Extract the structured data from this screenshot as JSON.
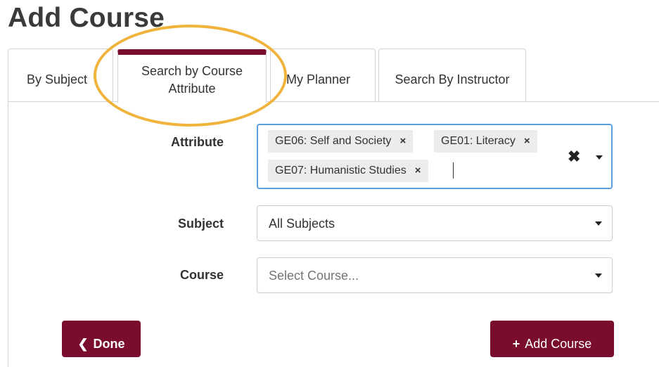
{
  "page": {
    "title": "Add Course"
  },
  "tabs": [
    {
      "label": "By Subject"
    },
    {
      "label": "Search by Course Attribute"
    },
    {
      "label": "My Planner"
    },
    {
      "label": "Search By Instructor"
    }
  ],
  "active_tab": "Search by Course Attribute",
  "form": {
    "attribute": {
      "label": "Attribute",
      "chips": [
        {
          "label": "GE06: Self and Society"
        },
        {
          "label": "GE01: Literacy"
        },
        {
          "label": "GE07: Humanistic Studies"
        }
      ],
      "remove_glyph": "×",
      "clear_glyph": "✖"
    },
    "subject": {
      "label": "Subject",
      "value": "All Subjects"
    },
    "course": {
      "label": "Course",
      "placeholder": "Select Course..."
    }
  },
  "buttons": {
    "done": {
      "icon": "chevron-left-icon",
      "glyph": "❮",
      "label": "Done"
    },
    "add": {
      "icon": "plus-icon",
      "glyph": "+",
      "label": "Add Course"
    }
  },
  "colors": {
    "brand": "#7a0c2e",
    "focus": "#5b9ee0",
    "highlight": "#f0b43c"
  }
}
